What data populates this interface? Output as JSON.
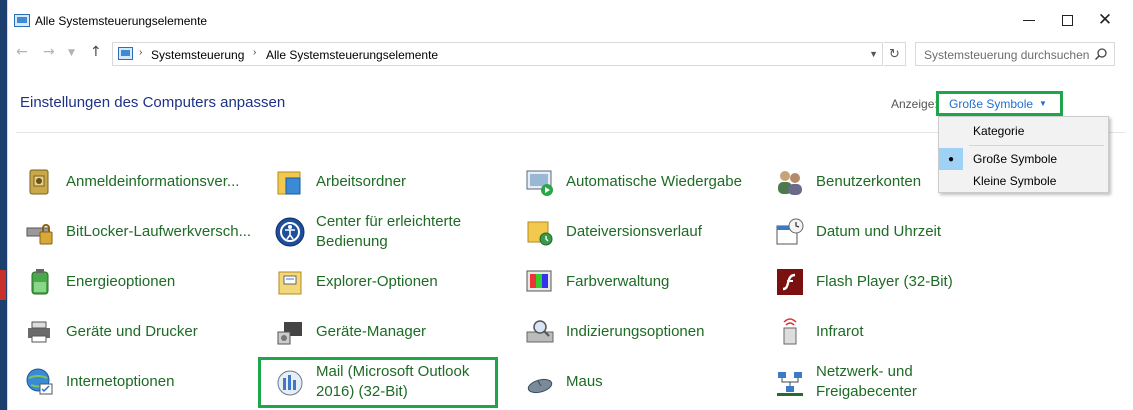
{
  "window": {
    "title": "Alle Systemsteuerungselemente"
  },
  "navigation": {
    "breadcrumbs": [
      "Systemsteuerung",
      "Alle Systemsteuerungselemente"
    ],
    "search_placeholder": "Systemsteuerung durchsuchen"
  },
  "header": {
    "title": "Einstellungen des Computers anpassen",
    "view_label": "Anzeige:",
    "view_value": "Große Symbole"
  },
  "view_menu": {
    "items": [
      "Kategorie",
      "Große Symbole",
      "Kleine Symbole"
    ],
    "selected": "Große Symbole"
  },
  "items": [
    {
      "label": "Anmeldeinformationsver...",
      "icon": "credential-manager-icon"
    },
    {
      "label": "Arbeitsordner",
      "icon": "work-folders-icon"
    },
    {
      "label": "Automatische Wiedergabe",
      "icon": "autoplay-icon"
    },
    {
      "label": "Benutzerkonten",
      "icon": "user-accounts-icon"
    },
    {
      "label": "BitLocker-Laufwerkversch...",
      "icon": "bitlocker-icon"
    },
    {
      "label": "Center für erleichterte Bedienung",
      "icon": "ease-of-access-icon"
    },
    {
      "label": "Dateiversionsverlauf",
      "icon": "file-history-icon"
    },
    {
      "label": "Datum und Uhrzeit",
      "icon": "date-time-icon"
    },
    {
      "label": "Energieoptionen",
      "icon": "power-options-icon"
    },
    {
      "label": "Explorer-Optionen",
      "icon": "explorer-options-icon"
    },
    {
      "label": "Farbverwaltung",
      "icon": "color-management-icon"
    },
    {
      "label": "Flash Player (32-Bit)",
      "icon": "flash-player-icon"
    },
    {
      "label": "Geräte und Drucker",
      "icon": "devices-printers-icon"
    },
    {
      "label": "Geräte-Manager",
      "icon": "device-manager-icon"
    },
    {
      "label": "Indizierungsoptionen",
      "icon": "indexing-options-icon"
    },
    {
      "label": "Infrarot",
      "icon": "infrared-icon"
    },
    {
      "label": "Internetoptionen",
      "icon": "internet-options-icon"
    },
    {
      "label": "Mail (Microsoft Outlook 2016) (32-Bit)",
      "icon": "mail-icon"
    },
    {
      "label": "Maus",
      "icon": "mouse-icon"
    },
    {
      "label": "Netzwerk- und Freigabecenter",
      "icon": "network-sharing-icon"
    }
  ],
  "labels_wrapped": {
    "item5_line1": "Center für erleichterte",
    "item5_line2": "Bedienung",
    "item17_line1": "Mail (Microsoft Outlook",
    "item17_line2": "2016) (32-Bit)",
    "item19_line1": "Netzwerk- und",
    "item19_line2": "Freigabecenter"
  },
  "colors": {
    "link_green": "#1d6b24",
    "title_blue": "#1e3287",
    "highlight_green": "#1ea64a",
    "view_blue": "#1f6fd1"
  }
}
